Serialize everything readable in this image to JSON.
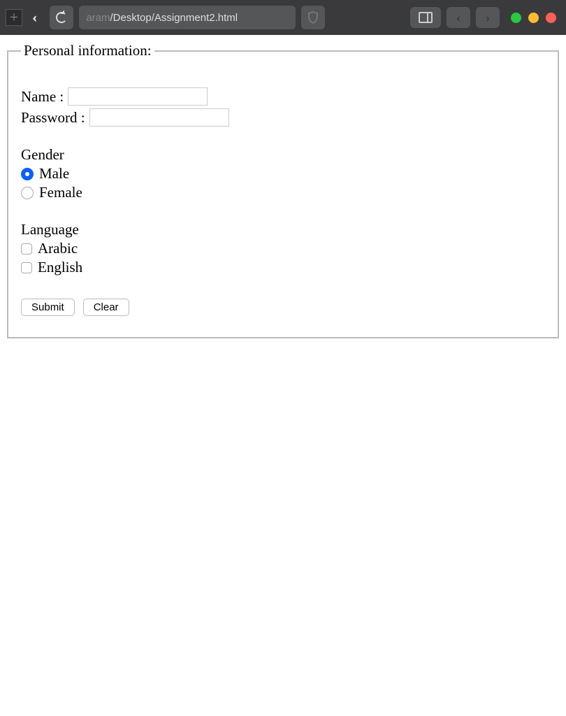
{
  "browser": {
    "url_prefix": "aram",
    "url_main": "/Desktop/Assignment2.html"
  },
  "form": {
    "legend": "Personal information:",
    "name_label": "Name :",
    "name_value": "",
    "password_label": "Password :",
    "password_value": "",
    "gender_label": "Gender",
    "gender_options": [
      {
        "label": "Male",
        "checked": true
      },
      {
        "label": "Female",
        "checked": false
      }
    ],
    "language_label": "Language",
    "language_options": [
      {
        "label": "Arabic",
        "checked": false
      },
      {
        "label": "English",
        "checked": false
      }
    ],
    "submit_label": "Submit",
    "clear_label": "Clear"
  }
}
